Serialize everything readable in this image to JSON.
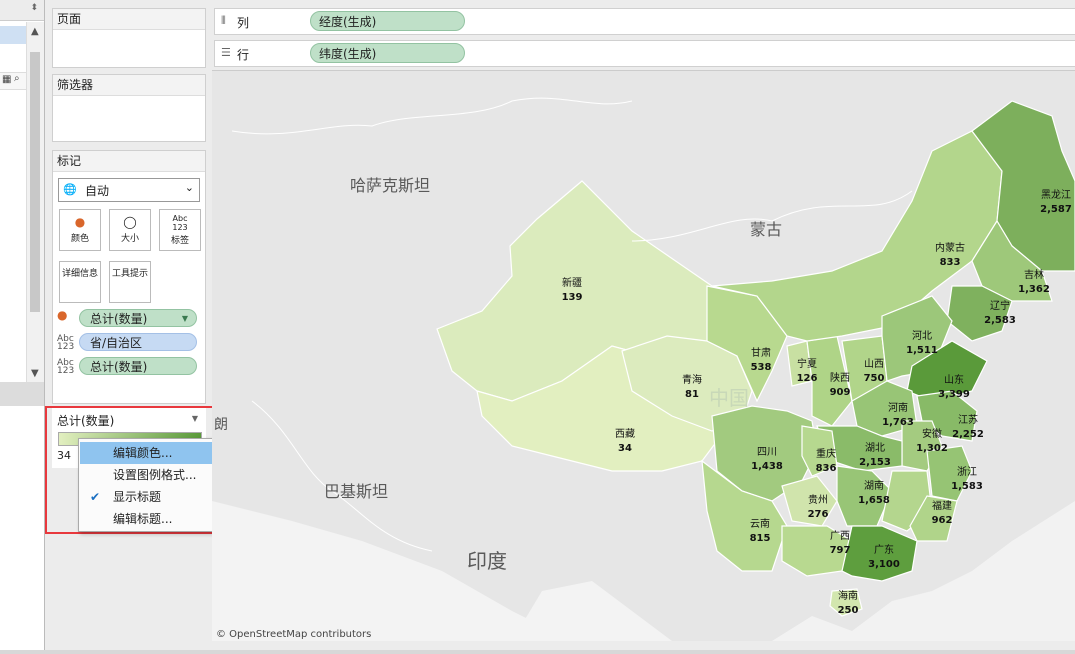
{
  "shelves": {
    "pages_title": "页面",
    "filters_title": "筛选器",
    "marks": {
      "title": "标记",
      "mark_type": "自动",
      "buttons": [
        "颜色",
        "大小",
        "标签",
        "详细信息",
        "工具提示"
      ],
      "label_glyph_top": "Abc",
      "label_glyph_bottom": "123",
      "pills": [
        {
          "text": "总计(数量)",
          "kind": "color"
        },
        {
          "text": "省/自治区",
          "kind": "label"
        },
        {
          "text": "总计(数量)",
          "kind": "label"
        }
      ]
    }
  },
  "columns": {
    "label": "列",
    "pill": "经度(生成)"
  },
  "rows": {
    "label": "行",
    "pill": "纬度(生成)"
  },
  "legend": {
    "title": "总计(数量)",
    "min": "34",
    "ramp_from": "#e2efc0",
    "ramp_to": "#5a9a3a"
  },
  "context_menu": {
    "items": [
      "编辑颜色...",
      "设置图例格式...",
      "显示标题",
      "编辑标题..."
    ],
    "highlighted_index": 0,
    "checked_index": 2
  },
  "map": {
    "attribution": "© OpenStreetMap contributors",
    "place_labels": [
      "哈萨克斯坦",
      "蒙古",
      "巴基斯坦",
      "印度",
      "中国",
      "朗"
    ],
    "provinces": [
      {
        "name": "新疆",
        "value": "139"
      },
      {
        "name": "西藏",
        "value": "34"
      },
      {
        "name": "青海",
        "value": "81"
      },
      {
        "name": "甘肃",
        "value": "538"
      },
      {
        "name": "宁夏",
        "value": "126"
      },
      {
        "name": "陕西",
        "value": "909"
      },
      {
        "name": "山西",
        "value": "750"
      },
      {
        "name": "内蒙古",
        "value": "833"
      },
      {
        "name": "黑龙江",
        "value": "2,587"
      },
      {
        "name": "吉林",
        "value": "1,362"
      },
      {
        "name": "辽宁",
        "value": "2,583"
      },
      {
        "name": "河北",
        "value": "1,511"
      },
      {
        "name": "山东",
        "value": "3,399"
      },
      {
        "name": "河南",
        "value": "1,763"
      },
      {
        "name": "江苏",
        "value": "2,252"
      },
      {
        "name": "安徽",
        "value": "1,302"
      },
      {
        "name": "湖北",
        "value": "2,153"
      },
      {
        "name": "四川",
        "value": "1,438"
      },
      {
        "name": "重庆",
        "value": "836"
      },
      {
        "name": "湖南",
        "value": "1,658"
      },
      {
        "name": "浙江",
        "value": "1,583"
      },
      {
        "name": "福建",
        "value": "962"
      },
      {
        "name": "贵州",
        "value": "276"
      },
      {
        "name": "云南",
        "value": "815"
      },
      {
        "name": "广西",
        "value": "797"
      },
      {
        "name": "广东",
        "value": "3,100"
      },
      {
        "name": "海南",
        "value": "250"
      }
    ]
  }
}
